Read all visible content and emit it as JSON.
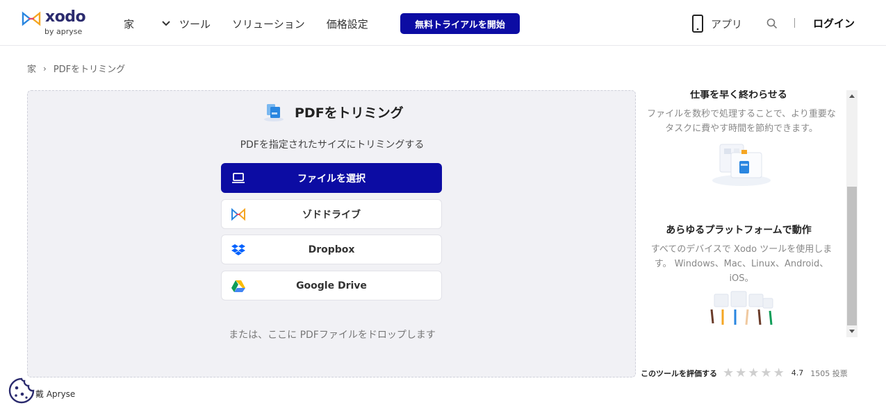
{
  "header": {
    "logo_word": "xodo",
    "logo_sub": "by apryse",
    "nav": {
      "home": "家",
      "tools": "ツール",
      "solutions": "ソリューション",
      "pricing": "価格設定"
    },
    "cta": "無料トライアルを開始",
    "app": "アプリ",
    "login": "ログイン"
  },
  "breadcrumb": {
    "home": "家",
    "separator": "›",
    "current": "PDFをトリミング"
  },
  "main": {
    "title": "PDFをトリミング",
    "subtitle": "PDFを指定されたサイズにトリミングする",
    "pickers": {
      "file": "ファイルを選択",
      "xodo_drive": "ゾドドライブ",
      "dropbox": "Dropbox",
      "google_drive": "Google Drive"
    },
    "drop_hint": "または、ここに PDFファイルをドロップします"
  },
  "side": {
    "section1_title": "仕事を早く終わらせる",
    "section1_text": "ファイルを数秒で処理することで、より重要なタスクに費やす時間を節約できます。",
    "section2_title": "あらゆるプラットフォームで動作",
    "section2_text": "すべてのデバイスで Xodo ツールを使用します。 Windows、Mac、Linux、Android、iOS。"
  },
  "rating": {
    "label": "このツールを評価する",
    "score": "4.7",
    "votes": "1505 投票",
    "stars_filled": 0,
    "stars_total": 5
  },
  "footer": {
    "text": "戴 Apryse"
  },
  "colors": {
    "brand": "#0c0ca3",
    "dropzone_bg": "#f1f1f5"
  }
}
